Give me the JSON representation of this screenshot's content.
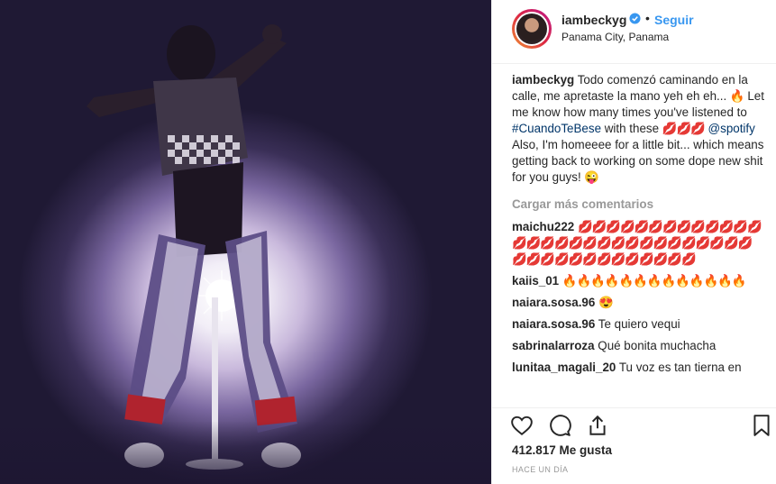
{
  "post": {
    "username": "iambeckyg",
    "follow_label": "Seguir",
    "location": "Panama City, Panama",
    "caption": {
      "user": "iambeckyg",
      "text_1": " Todo comenzó caminando en la calle, me apretaste la mano yeh eh eh... ",
      "fire": "🔥",
      "text_2": " Let me know how many times you've listened to ",
      "hashtag": "#CuandoTeBese",
      "text_3": " with these ",
      "lips": "💋💋💋",
      "text_4": " ",
      "mention": "@spotify",
      "text_5": " Also, I'm homeeee for a little bit... which means getting back to working on some dope new shit for you guys! ",
      "wink": "😜"
    },
    "load_more": "Cargar más comentarios",
    "comments": [
      {
        "user": "maichu222",
        "text": "💋💋💋💋💋💋💋💋💋💋💋💋💋💋💋💋💋💋💋💋💋💋💋💋💋💋💋💋💋💋💋💋💋💋💋💋💋💋💋💋💋💋💋",
        "style": "lips"
      },
      {
        "user": "kaiis_01",
        "text": "🔥🔥🔥🔥🔥🔥🔥🔥🔥🔥🔥🔥🔥",
        "style": "fire"
      },
      {
        "user": "naiara.sosa.96",
        "text": "😍",
        "style": "plain"
      },
      {
        "user": "naiara.sosa.96",
        "text": "Te quiero vequi",
        "style": "plain"
      },
      {
        "user": "sabrinalarroza",
        "text": "Qué bonita muchacha",
        "style": "plain"
      },
      {
        "user": "lunitaa_magali_20",
        "text": "Tu voz es tan tierna en",
        "style": "plain"
      }
    ],
    "likes": "412.817 Me gusta",
    "time": "HACE UN DÍA"
  },
  "icons": [
    "heart-icon",
    "comment-icon",
    "share-icon",
    "bookmark-icon",
    "verified-icon"
  ]
}
